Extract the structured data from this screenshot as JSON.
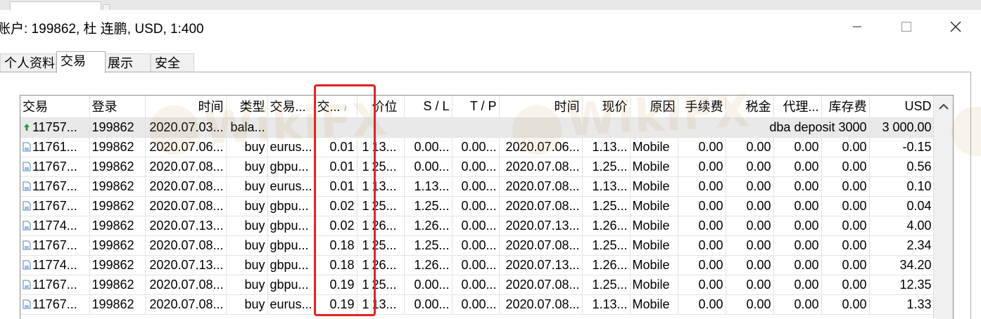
{
  "window": {
    "title": "账户: 199862, 杜 连鹏, USD, 1:400",
    "minimize_icon": "minimize-icon",
    "maximize_icon": "maximize-icon",
    "close_icon": "close-icon"
  },
  "tabs": [
    {
      "label": "个人资料",
      "active": false
    },
    {
      "label": "交易",
      "active": true
    },
    {
      "label": "展示",
      "active": false
    },
    {
      "label": "安全",
      "active": false
    }
  ],
  "table": {
    "columns": [
      "交易",
      "登录",
      "时间",
      "类型",
      "交易...",
      "交...",
      "",
      "价位",
      "S / L",
      "T / P",
      "时间",
      "现价",
      "原因",
      "手续费",
      "税金",
      "代理...",
      "库存费",
      "USD"
    ],
    "balance_row": {
      "ticket": "11757...",
      "login": "199862",
      "time": "2020.07.03...",
      "type": "bala...",
      "comment": "dba deposit 3000",
      "usd": "3 000.00"
    },
    "rows": [
      [
        "11761...",
        "199862",
        "2020.07.06...",
        "buy",
        "eurus...",
        "0.01",
        "1",
        "13...",
        "0.00...",
        "0.00...",
        "2020.07.06...",
        "1.13...",
        "Mobile",
        "0.00",
        "0.00",
        "0.00",
        "0.00",
        "-0.15"
      ],
      [
        "11767...",
        "199862",
        "2020.07.08...",
        "buy",
        "gbpu...",
        "0.01",
        "1",
        "25...",
        "0.00...",
        "0.00...",
        "2020.07.08...",
        "1.25...",
        "Mobile",
        "0.00",
        "0.00",
        "0.00",
        "0.00",
        "0.56"
      ],
      [
        "11767...",
        "199862",
        "2020.07.08...",
        "buy",
        "eurus...",
        "0.01",
        "1",
        "13...",
        "1.13...",
        "0.00...",
        "2020.07.08...",
        "1.13...",
        "Mobile",
        "0.00",
        "0.00",
        "0.00",
        "0.00",
        "0.10"
      ],
      [
        "11767...",
        "199862",
        "2020.07.08...",
        "buy",
        "gbpu...",
        "0.02",
        "1",
        "25...",
        "1.25...",
        "0.00...",
        "2020.07.08...",
        "1.25...",
        "Mobile",
        "0.00",
        "0.00",
        "0.00",
        "0.00",
        "0.04"
      ],
      [
        "11774...",
        "199862",
        "2020.07.13...",
        "buy",
        "gbpu...",
        "0.02",
        "1",
        "26...",
        "1.26...",
        "0.00...",
        "2020.07.13...",
        "1.26...",
        "Mobile",
        "0.00",
        "0.00",
        "0.00",
        "0.00",
        "4.00"
      ],
      [
        "11767...",
        "199862",
        "2020.07.08...",
        "buy",
        "gbpu...",
        "0.18",
        "1",
        "25...",
        "1.25...",
        "0.00...",
        "2020.07.08...",
        "1.25...",
        "Mobile",
        "0.00",
        "0.00",
        "0.00",
        "0.00",
        "2.34"
      ],
      [
        "11774...",
        "199862",
        "2020.07.13...",
        "buy",
        "gbpu...",
        "0.18",
        "1",
        "26...",
        "1.26...",
        "0.00...",
        "2020.07.13...",
        "1.26...",
        "Mobile",
        "0.00",
        "0.00",
        "0.00",
        "0.00",
        "34.20"
      ],
      [
        "11767...",
        "199862",
        "2020.07.08...",
        "buy",
        "gbpu...",
        "0.19",
        "1",
        "25...",
        "0.00...",
        "0.00...",
        "2020.07.08...",
        "1.25...",
        "Mobile",
        "0.00",
        "0.00",
        "0.00",
        "0.00",
        "12.35"
      ],
      [
        "11767...",
        "199862",
        "2020.07.08...",
        "buy",
        "eurus...",
        "0.19",
        "1",
        "13...",
        "0.00...",
        "0.00...",
        "2020.07.08...",
        "1.13...",
        "Mobile",
        "0.00",
        "0.00",
        "0.00",
        "0.00",
        "1.33"
      ]
    ]
  },
  "watermark": {
    "text": "WikiFX"
  },
  "colors": {
    "highlight": "#e02424",
    "balance_row_bg": "#e9e9e9",
    "deposit_icon": "#2e9b3e",
    "position_icon": "#3a7bd5"
  },
  "icons": {
    "deposit": "deposit-arrow-icon",
    "position": "position-doc-icon",
    "scroll_up": "chevron-up-icon"
  }
}
